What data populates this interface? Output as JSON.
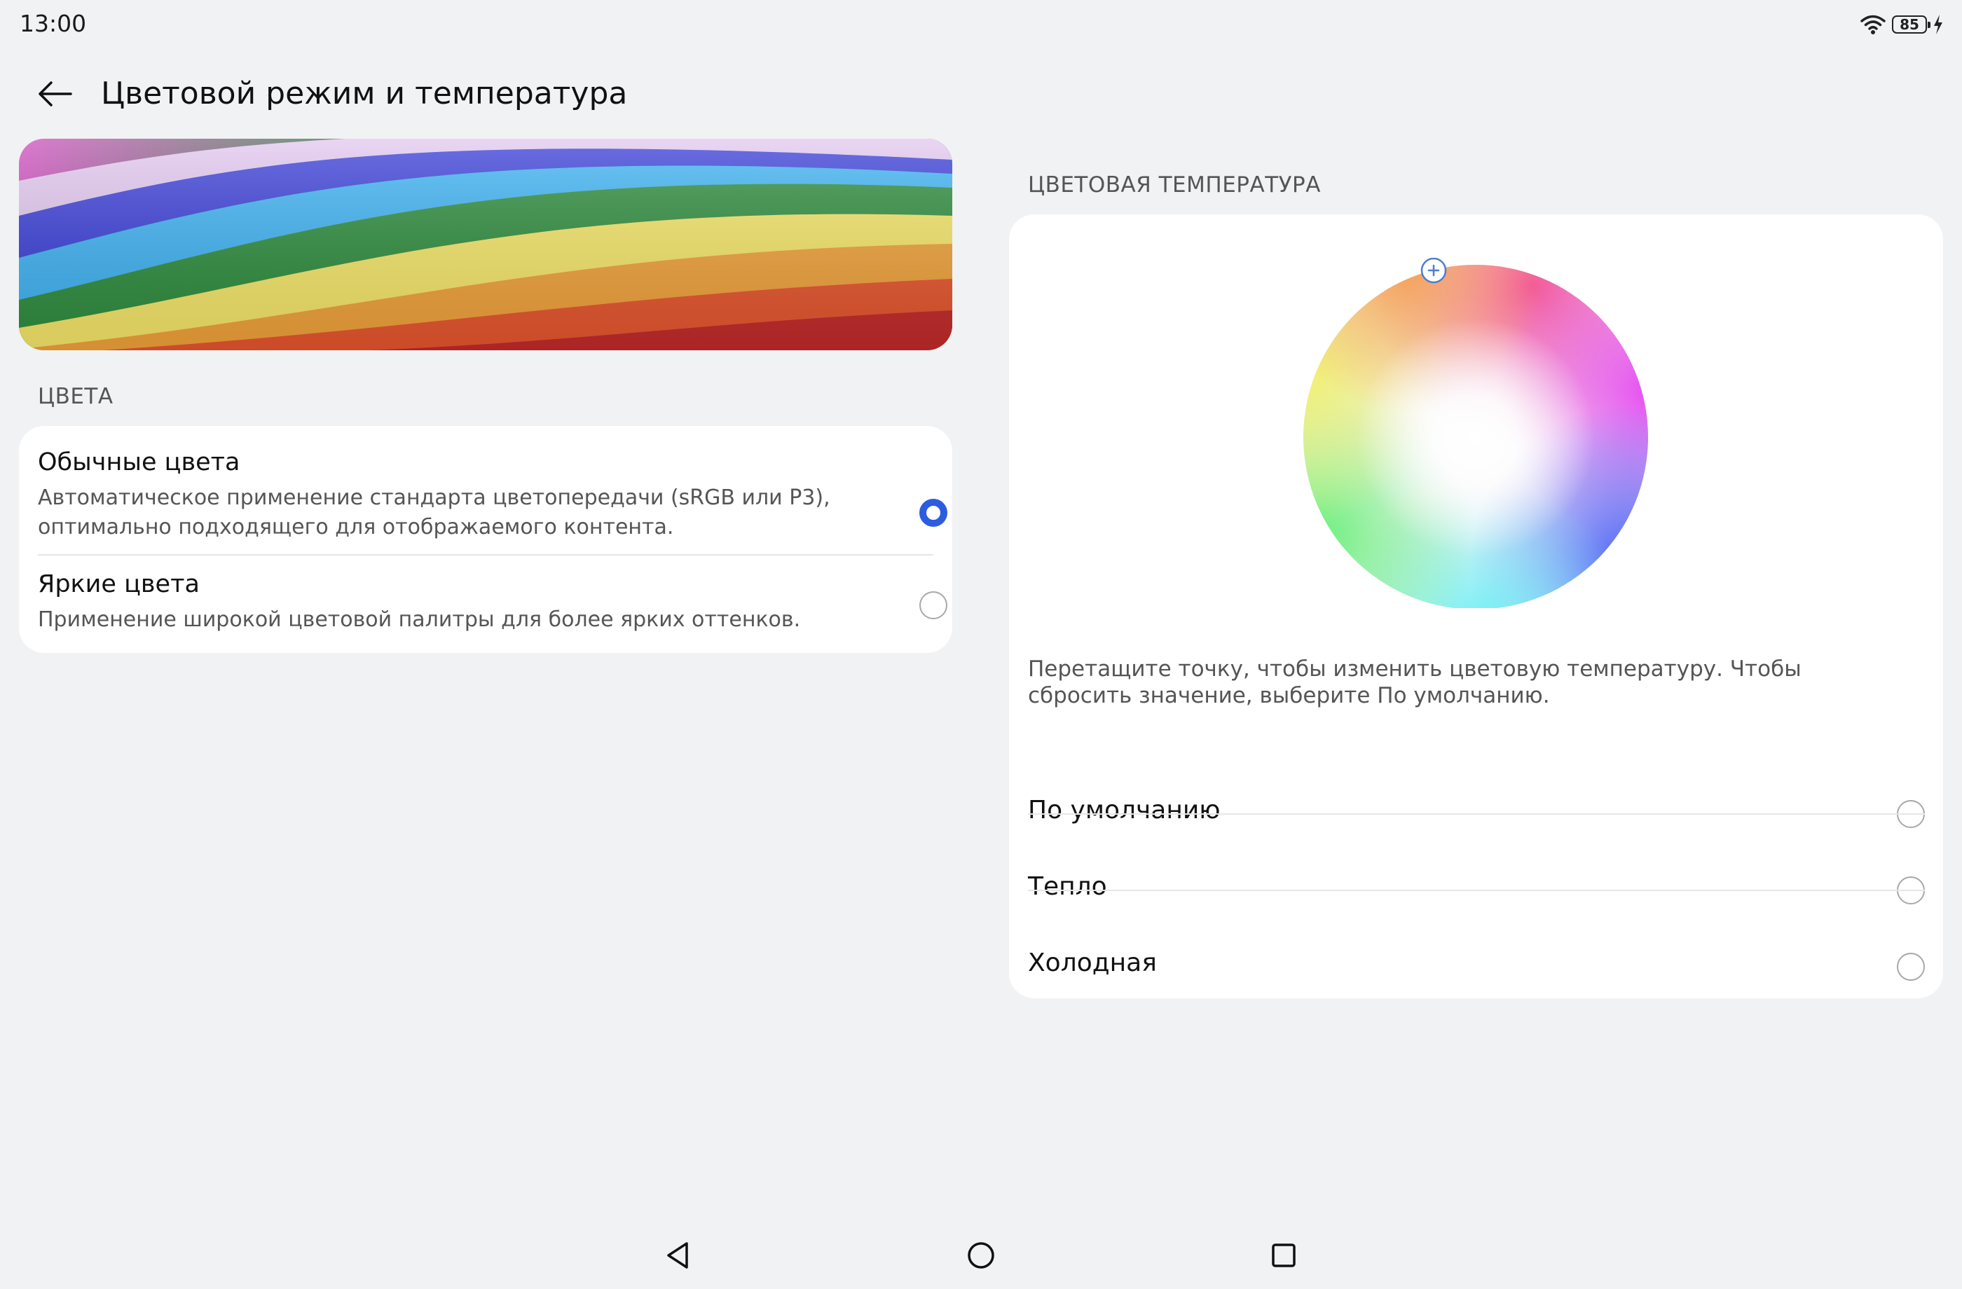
{
  "status_bar": {
    "time": "13:00",
    "battery_level": "85",
    "icons": [
      "wifi-icon",
      "battery-icon",
      "charging-bolt-icon"
    ]
  },
  "header": {
    "title": "Цветовой режим и температура",
    "back_icon": "arrow-left-icon"
  },
  "colors_section": {
    "label": "ЦВЕТА",
    "options": [
      {
        "title": "Обычные цвета",
        "description": "Автоматическое применение стандарта цветопередачи (sRGB или P3), оптимально подходящего для отображаемого контента.",
        "selected": true
      },
      {
        "title": "Яркие цвета",
        "description": "Применение широкой цветовой палитры для более ярких оттенков.",
        "selected": false
      }
    ]
  },
  "temperature_section": {
    "label": "ЦВЕТОВАЯ ТЕМПЕРАТУРА",
    "hint": "Перетащите точку, чтобы изменить цветовую температуру. Чтобы сбросить значение, выберите По умолчанию.",
    "options": [
      {
        "label": "По умолчанию",
        "selected": false
      },
      {
        "label": "Тепло",
        "selected": false
      },
      {
        "label": "Холодная",
        "selected": false
      }
    ]
  },
  "colors": {
    "background": "#F1F2F4",
    "card": "#FFFFFF",
    "accent": "#2C5CE0"
  },
  "nav_bar": {
    "icons": [
      "nav-back-icon",
      "nav-home-icon",
      "nav-recents-icon"
    ]
  }
}
